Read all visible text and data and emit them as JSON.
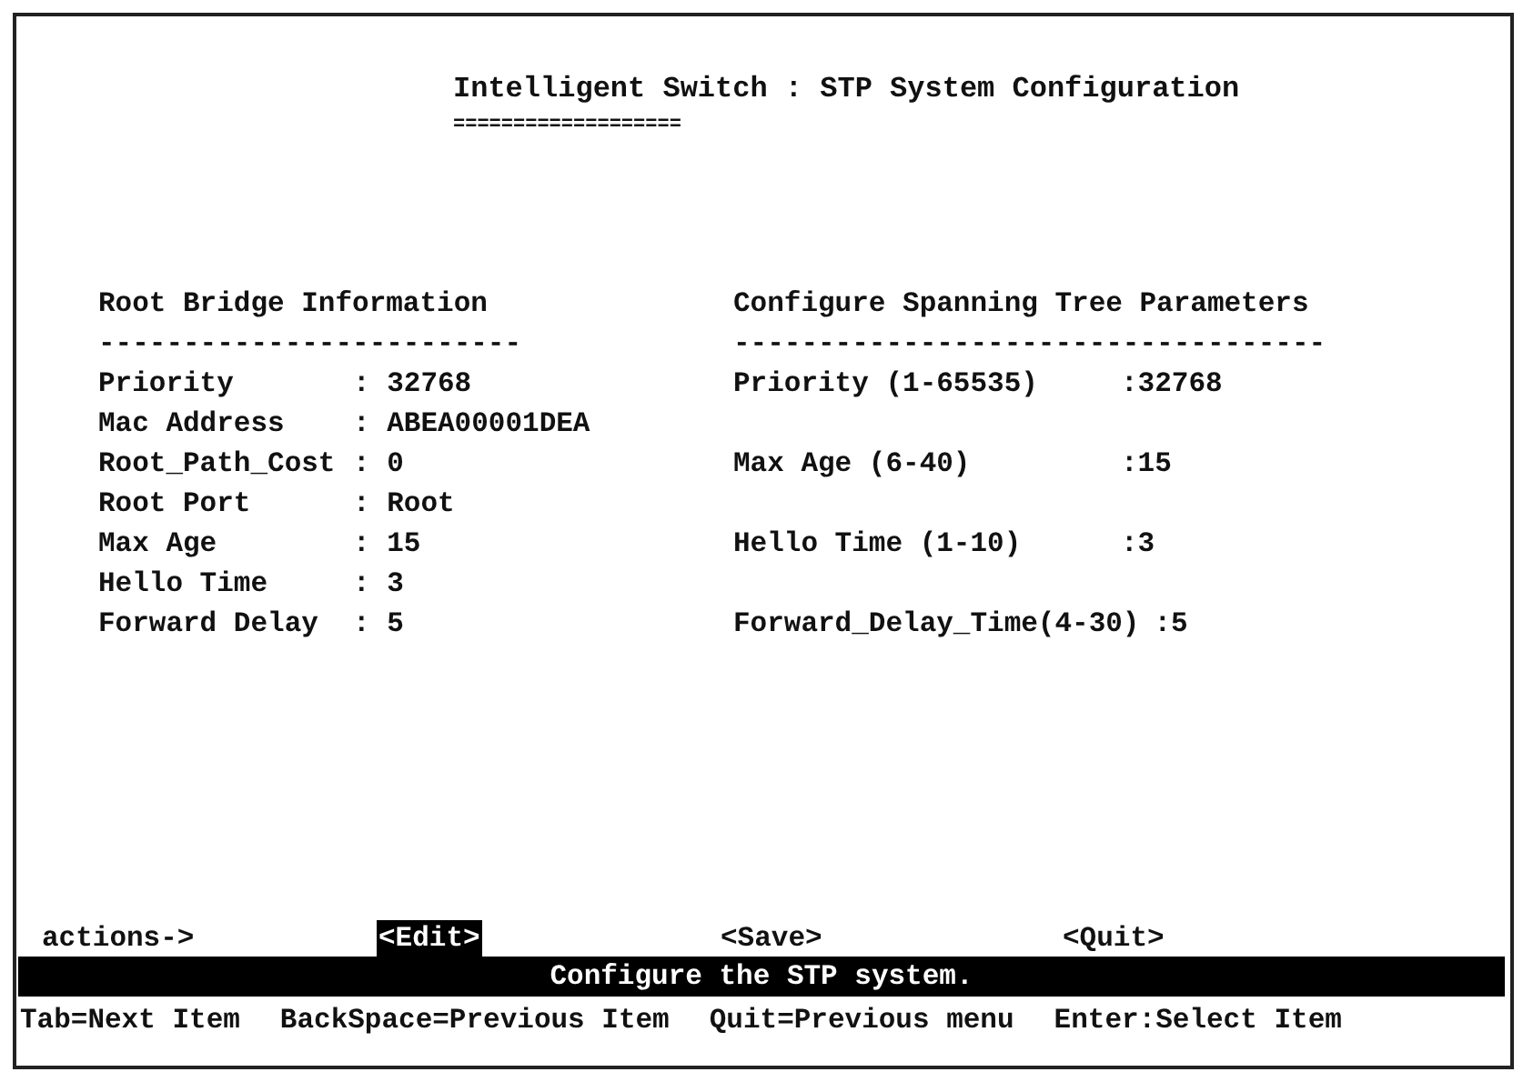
{
  "title": "Intelligent Switch : STP System Configuration",
  "title_underline": "===================",
  "root_bridge": {
    "heading": "Root Bridge Information",
    "rule": "-------------------------",
    "fields": [
      {
        "label": "Priority",
        "value": ": 32768"
      },
      {
        "label": "Mac Address",
        "value": ": ABEA00001DEA"
      },
      {
        "label": "Root_Path_Cost",
        "value": ": 0"
      },
      {
        "label": "Root Port",
        "value": ": Root"
      },
      {
        "label": "Max Age",
        "value": ": 15"
      },
      {
        "label": "Hello Time",
        "value": ": 3"
      },
      {
        "label": "Forward Delay",
        "value": ": 5"
      }
    ]
  },
  "spanning_tree": {
    "heading": "Configure Spanning Tree Parameters",
    "rule": "-----------------------------------",
    "fields": [
      {
        "label": "Priority (1-65535)",
        "value": ":32768"
      },
      {
        "label": "Max Age (6-40)",
        "value": ":15"
      },
      {
        "label": "Hello Time (1-10)",
        "value": ":3"
      },
      {
        "label": "Forward_Delay_Time(4-30)",
        "value": ":5"
      }
    ]
  },
  "actions": {
    "label": "actions->",
    "items": [
      {
        "label": "<Edit>",
        "selected": true
      },
      {
        "label": "<Save>",
        "selected": false
      },
      {
        "label": "<Quit>",
        "selected": false
      }
    ]
  },
  "status": "Configure the STP system.",
  "help": [
    "Tab=Next Item",
    "BackSpace=Previous Item",
    "Quit=Previous menu",
    "Enter:Select Item"
  ]
}
